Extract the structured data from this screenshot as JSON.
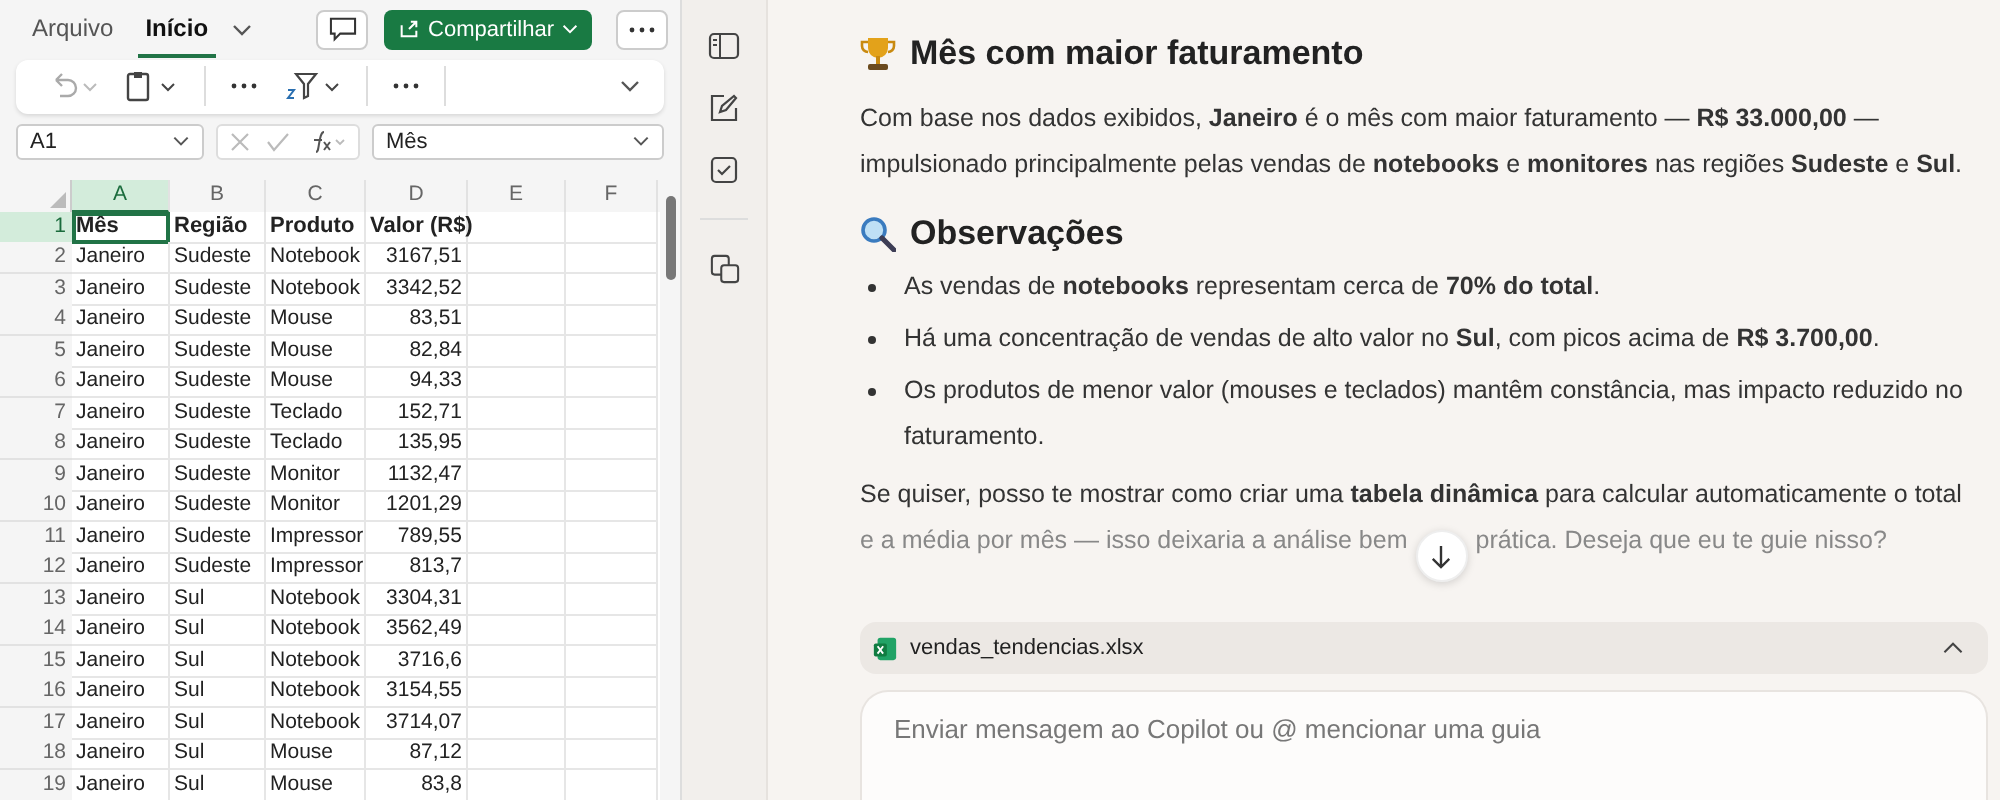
{
  "excel": {
    "tabs": [
      {
        "label": "Arquivo",
        "selected": false
      },
      {
        "label": "Início",
        "selected": true
      }
    ],
    "share_button": "Compartilhar",
    "name_box": "A1",
    "formula": "Mês",
    "columns": [
      {
        "label": "A",
        "selected": true
      },
      {
        "label": "B",
        "selected": false
      },
      {
        "label": "C",
        "selected": false
      },
      {
        "label": "D",
        "selected": false
      },
      {
        "label": "E",
        "selected": false
      },
      {
        "label": "F",
        "selected": false
      }
    ],
    "rows": [
      {
        "number": "1",
        "selected": true,
        "kind": "header",
        "cells": [
          "Mês",
          "Região",
          "Produto",
          "Valor (R$)"
        ]
      },
      {
        "number": "2",
        "selected": false,
        "kind": "data",
        "cells": [
          "Janeiro",
          "Sudeste",
          "Notebook",
          "3167,51"
        ]
      },
      {
        "number": "3",
        "selected": false,
        "kind": "data",
        "cells": [
          "Janeiro",
          "Sudeste",
          "Notebook",
          "3342,52"
        ]
      },
      {
        "number": "4",
        "selected": false,
        "kind": "data",
        "cells": [
          "Janeiro",
          "Sudeste",
          "Mouse",
          "83,51"
        ]
      },
      {
        "number": "5",
        "selected": false,
        "kind": "data",
        "cells": [
          "Janeiro",
          "Sudeste",
          "Mouse",
          "82,84"
        ]
      },
      {
        "number": "6",
        "selected": false,
        "kind": "data",
        "cells": [
          "Janeiro",
          "Sudeste",
          "Mouse",
          "94,33"
        ]
      },
      {
        "number": "7",
        "selected": false,
        "kind": "data",
        "cells": [
          "Janeiro",
          "Sudeste",
          "Teclado",
          "152,71"
        ]
      },
      {
        "number": "8",
        "selected": false,
        "kind": "data",
        "cells": [
          "Janeiro",
          "Sudeste",
          "Teclado",
          "135,95"
        ]
      },
      {
        "number": "9",
        "selected": false,
        "kind": "data",
        "cells": [
          "Janeiro",
          "Sudeste",
          "Monitor",
          "1132,47"
        ]
      },
      {
        "number": "10",
        "selected": false,
        "kind": "data",
        "cells": [
          "Janeiro",
          "Sudeste",
          "Monitor",
          "1201,29"
        ]
      },
      {
        "number": "11",
        "selected": false,
        "kind": "data",
        "cells": [
          "Janeiro",
          "Sudeste",
          "Impressor",
          "789,55"
        ]
      },
      {
        "number": "12",
        "selected": false,
        "kind": "data",
        "cells": [
          "Janeiro",
          "Sudeste",
          "Impressor",
          "813,7"
        ]
      },
      {
        "number": "13",
        "selected": false,
        "kind": "data",
        "cells": [
          "Janeiro",
          "Sul",
          "Notebook",
          "3304,31"
        ]
      },
      {
        "number": "14",
        "selected": false,
        "kind": "data",
        "cells": [
          "Janeiro",
          "Sul",
          "Notebook",
          "3562,49"
        ]
      },
      {
        "number": "15",
        "selected": false,
        "kind": "data",
        "cells": [
          "Janeiro",
          "Sul",
          "Notebook",
          "3716,6"
        ]
      },
      {
        "number": "16",
        "selected": false,
        "kind": "data",
        "cells": [
          "Janeiro",
          "Sul",
          "Notebook",
          "3154,55"
        ]
      },
      {
        "number": "17",
        "selected": false,
        "kind": "data",
        "cells": [
          "Janeiro",
          "Sul",
          "Notebook",
          "3714,07"
        ]
      },
      {
        "number": "18",
        "selected": false,
        "kind": "data",
        "cells": [
          "Janeiro",
          "Sul",
          "Mouse",
          "87,12"
        ]
      },
      {
        "number": "19",
        "selected": false,
        "kind": "data",
        "cells": [
          "Janeiro",
          "Sul",
          "Mouse",
          "83,8"
        ]
      }
    ]
  },
  "copilot": {
    "heading_1": "Mês com maior faturamento",
    "paragraph_1": "Com base nos dados exibidos, **Janeiro** é o mês com maior faturamento — **R$ 33.000,00** — impulsionado principalmente pelas vendas de **notebooks** e **monitores** nas regiões **Sudeste** e **Sul**.",
    "heading_2": "Observações",
    "bullets": [
      "As vendas de **notebooks** representam cerca de **70% do total**.",
      "Há uma concentração de vendas de alto valor no **Sul**, com picos acima de **R$ 3.700,00**.",
      "Os produtos de menor valor (mouses e teclados) mantêm constância, mas impacto reduzido no faturamento."
    ],
    "paragraph_2": "Se quiser, posso te mostrar como criar uma **tabela dinâmica** para calcular automaticamente o total",
    "faded_line": [
      "e a média por mês — isso deixaria a análise bem",
      "prática. Deseja que eu te guie nisso?"
    ],
    "attachment": "vendas_tendencias.xlsx",
    "input_placeholder": "Enviar mensagem ao Copilot ou @ mencionar uma guia"
  }
}
